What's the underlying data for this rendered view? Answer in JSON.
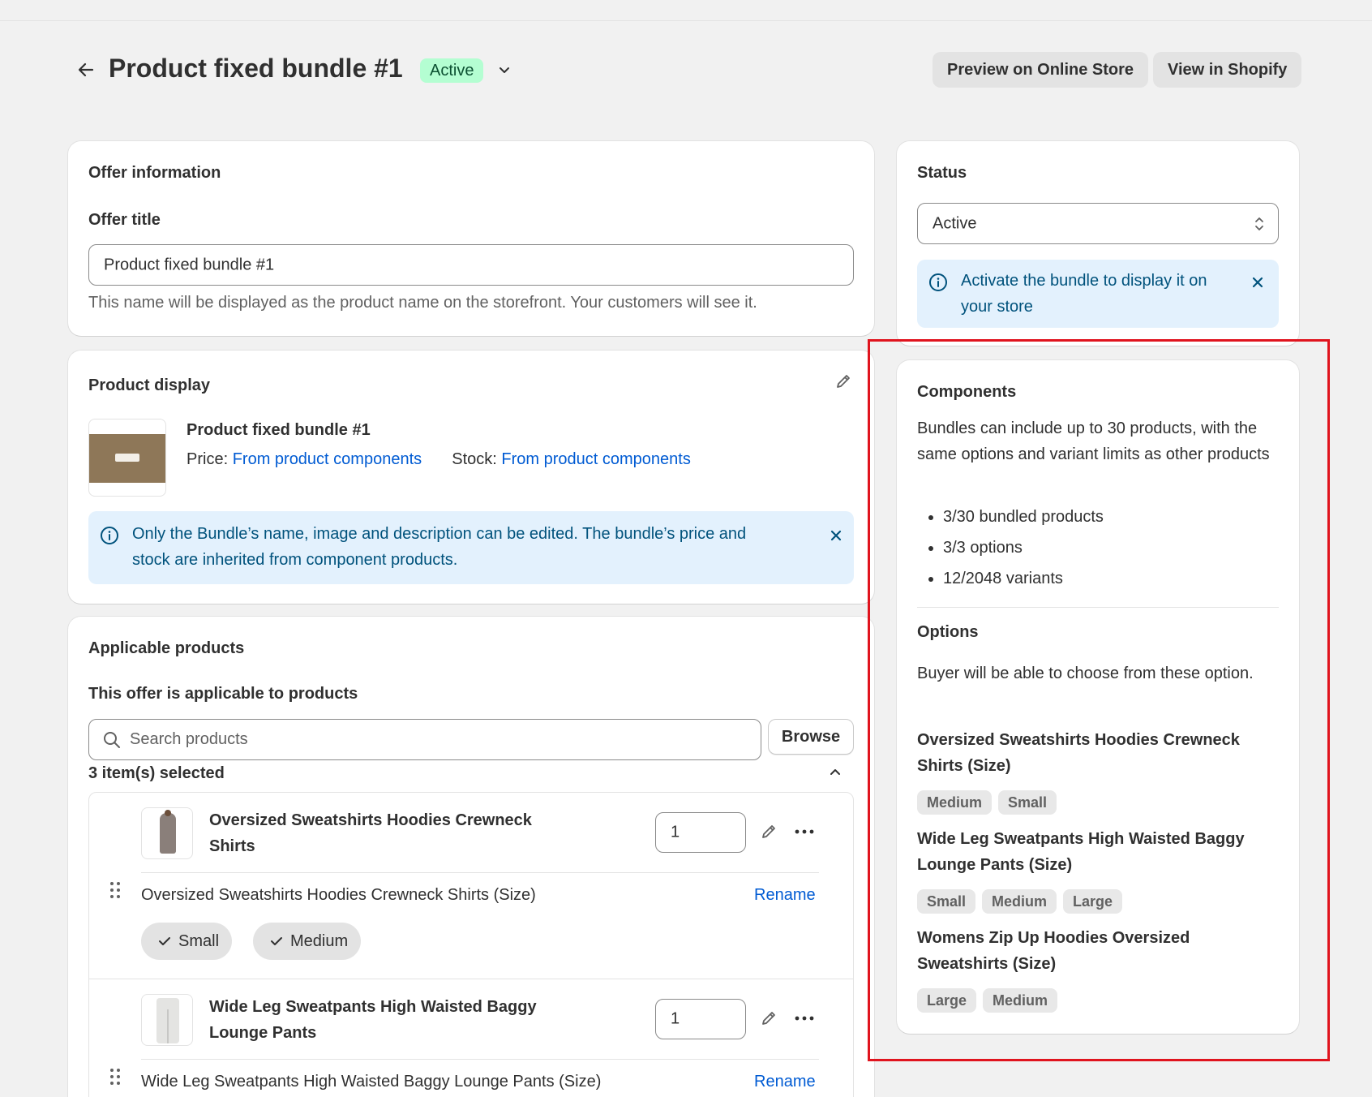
{
  "header": {
    "title": "Product fixed bundle #1",
    "badge": "Active",
    "preview_button": "Preview on Online Store",
    "view_button": "View in Shopify"
  },
  "offer_info": {
    "card_title": "Offer information",
    "field_label": "Offer title",
    "field_value": "Product fixed bundle #1",
    "help_text": "This name will be displayed as the product name on the storefront. Your customers will see it."
  },
  "product_display": {
    "card_title": "Product display",
    "product_name": "Product fixed bundle #1",
    "price_label": "Price:",
    "price_value": "From product components",
    "stock_label": "Stock:",
    "stock_value": "From product components",
    "banner_text": "Only the Bundle’s name, image and description can be edited. The bundle’s price and stock are inherited from component products."
  },
  "applicable_products": {
    "card_title": "Applicable products",
    "subtitle": "This offer is applicable to products",
    "search_placeholder": "Search products",
    "browse_button": "Browse",
    "selected_count": "3 item(s) selected",
    "items": [
      {
        "name": "Oversized Sweatshirts Hoodies Crewneck Shirts",
        "quantity": "1",
        "option_title": "Oversized Sweatshirts Hoodies Crewneck Shirts (Size)",
        "rename_label": "Rename",
        "choices": [
          "Small",
          "Medium"
        ]
      },
      {
        "name": "Wide Leg Sweatpants High Waisted Baggy Lounge Pants",
        "quantity": "1",
        "option_title": "Wide Leg Sweatpants High Waisted Baggy Lounge Pants (Size)",
        "rename_label": "Rename"
      }
    ]
  },
  "status": {
    "card_title": "Status",
    "select_value": "Active",
    "banner_text": "Activate the bundle to display it on your store"
  },
  "components": {
    "card_title": "Components",
    "description": "Bundles can include up to 30 products, with the same options and variant limits as other products",
    "bullets": [
      "3/30 bundled products",
      "3/3 options",
      "12/2048 variants"
    ],
    "options_title": "Options",
    "options_description": "Buyer will be able to choose from these option.",
    "option_groups": [
      {
        "title": "Oversized Sweatshirts Hoodies Crewneck Shirts (Size)",
        "values": [
          "Medium",
          "Small"
        ]
      },
      {
        "title": "Wide Leg Sweatpants High Waisted Baggy Lounge Pants (Size)",
        "values": [
          "Small",
          "Medium",
          "Large"
        ]
      },
      {
        "title": "Womens Zip Up Hoodies Oversized Sweatshirts (Size)",
        "values": [
          "Large",
          "Medium"
        ]
      }
    ]
  },
  "colors": {
    "badge_bg": "#b4fed2",
    "banner_bg": "#e3f1fd",
    "link": "#005bd3",
    "highlight": "#e0141e"
  }
}
